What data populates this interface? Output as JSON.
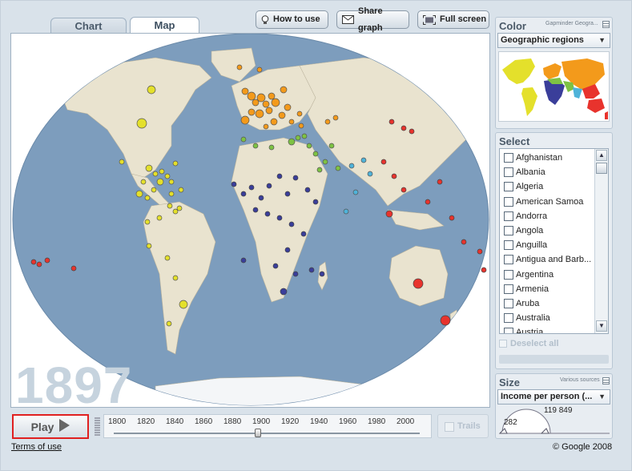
{
  "tabs": [
    {
      "label": "Chart",
      "active": false
    },
    {
      "label": "Map",
      "active": true
    }
  ],
  "toolbar": {
    "how_to_use": "How to use",
    "share_graph": "Share graph",
    "full_screen": "Full screen"
  },
  "map": {
    "year": "1897"
  },
  "controls": {
    "play_label": "Play",
    "timeline_labels": [
      "1800",
      "1820",
      "1840",
      "1860",
      "1880",
      "1900",
      "1920",
      "1940",
      "1960",
      "1980",
      "2000"
    ],
    "trails_label": "Trails"
  },
  "footer": {
    "terms": "Terms of use",
    "copyright": "© Google 2008"
  },
  "color_panel": {
    "title": "Color",
    "source": "Gapminder Geogra...",
    "selected": "Geographic regions"
  },
  "select_panel": {
    "title": "Select",
    "countries": [
      "Afghanistan",
      "Albania",
      "Algeria",
      "American Samoa",
      "Andorra",
      "Angola",
      "Anguilla",
      "Antigua and Barb...",
      "Argentina",
      "Armenia",
      "Aruba",
      "Australia",
      "Austria"
    ],
    "deselect_all": "Deselect all"
  },
  "size_panel": {
    "title": "Size",
    "source": "Various sources",
    "selected": "Income per person (...",
    "min_value": "282",
    "max_value": "119 849"
  },
  "colors": {
    "europe": "#f39a1b",
    "americas": "#e4e02b",
    "africa": "#3a3e9a",
    "east_asia_pacific": "#e8332d",
    "middle_east": "#7dc243",
    "south_asia": "#4fb3d9",
    "ocean": "#7d9dbd",
    "land": "#e9e3cf"
  }
}
